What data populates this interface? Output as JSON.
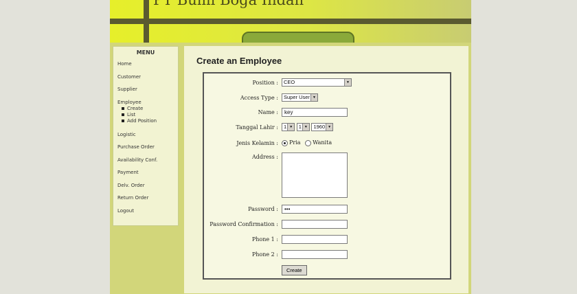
{
  "header": {
    "title": "PT Bumi Boga Indah"
  },
  "menu": {
    "heading": "MENU",
    "items": [
      {
        "label": "Home"
      },
      {
        "label": "Customer"
      },
      {
        "label": "Supplier"
      },
      {
        "label": "Employee",
        "subitems": [
          "Create",
          "List",
          "Add Position"
        ]
      },
      {
        "label": "Logistic"
      },
      {
        "label": "Purchase Order"
      },
      {
        "label": "Availability Conf."
      },
      {
        "label": "Payment"
      },
      {
        "label": "Delv. Order"
      },
      {
        "label": "Return Order"
      },
      {
        "label": "Logout"
      }
    ]
  },
  "form": {
    "title": "Create an Employee",
    "position": {
      "label": "Position :",
      "value": "CEO"
    },
    "access_type": {
      "label": "Access Type :",
      "value": "Super User"
    },
    "name": {
      "label": "Name :",
      "value": "key"
    },
    "birth": {
      "label": "Tanggal Lahir :",
      "day": "1",
      "month": "1",
      "year": "1960"
    },
    "gender": {
      "label": "Jenis Kelamin :",
      "option1": "Pria",
      "option2": "Wanita",
      "selected": "Pria"
    },
    "address": {
      "label": "Address :",
      "value": ""
    },
    "password": {
      "label": "Password :",
      "value": "•••"
    },
    "password_confirm": {
      "label": "Password Confirmation :",
      "value": ""
    },
    "phone1": {
      "label": "Phone 1 :",
      "value": ""
    },
    "phone2": {
      "label": "Phone 2 :",
      "value": ""
    },
    "submit_label": "Create"
  }
}
